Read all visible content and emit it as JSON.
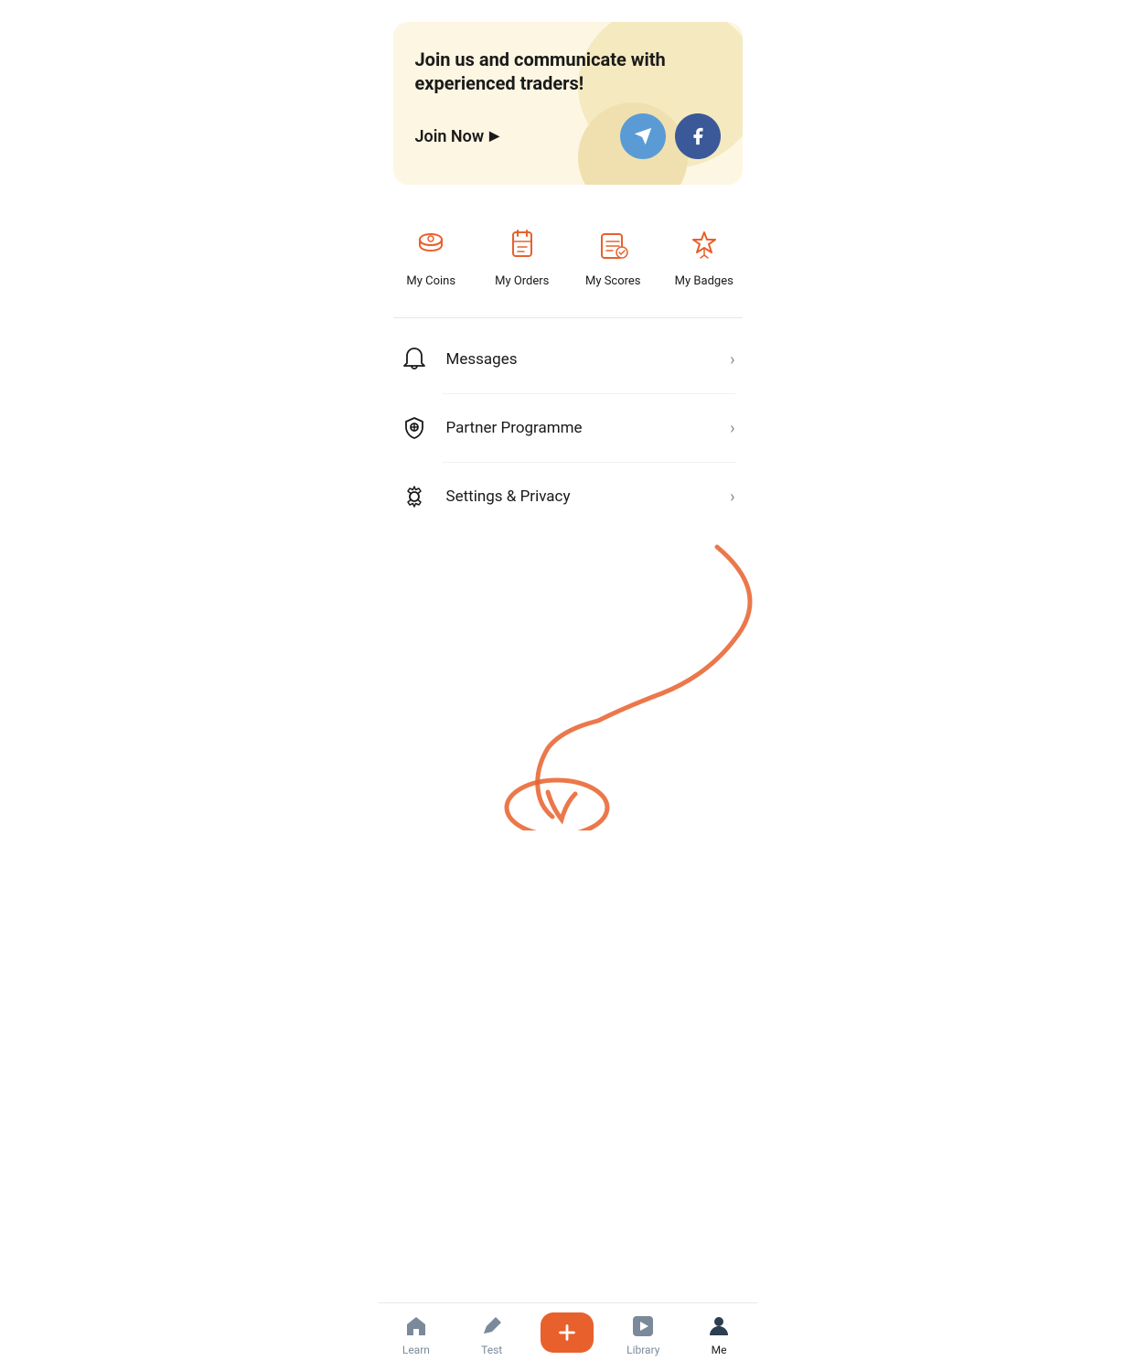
{
  "banner": {
    "title": "Join us and communicate with experienced traders!",
    "join_now_label": "Join Now",
    "telegram_label": "Telegram",
    "facebook_label": "Facebook"
  },
  "quick_actions": [
    {
      "id": "coins",
      "label": "My Coins",
      "icon": "coins"
    },
    {
      "id": "orders",
      "label": "My Orders",
      "icon": "orders"
    },
    {
      "id": "scores",
      "label": "My Scores",
      "icon": "scores"
    },
    {
      "id": "badges",
      "label": "My Badges",
      "icon": "badges"
    }
  ],
  "menu_items": [
    {
      "id": "messages",
      "label": "Messages",
      "icon": "bell"
    },
    {
      "id": "partner",
      "label": "Partner Programme",
      "icon": "shield"
    },
    {
      "id": "settings",
      "label": "Settings & Privacy",
      "icon": "gear"
    }
  ],
  "bottom_nav": [
    {
      "id": "learn",
      "label": "Learn",
      "icon": "home",
      "active": false
    },
    {
      "id": "test",
      "label": "Test",
      "icon": "pencil",
      "active": false
    },
    {
      "id": "create",
      "label": "",
      "icon": "plus",
      "active": false
    },
    {
      "id": "library",
      "label": "Library",
      "icon": "play",
      "active": false
    },
    {
      "id": "me",
      "label": "Me",
      "icon": "person",
      "active": true
    }
  ]
}
